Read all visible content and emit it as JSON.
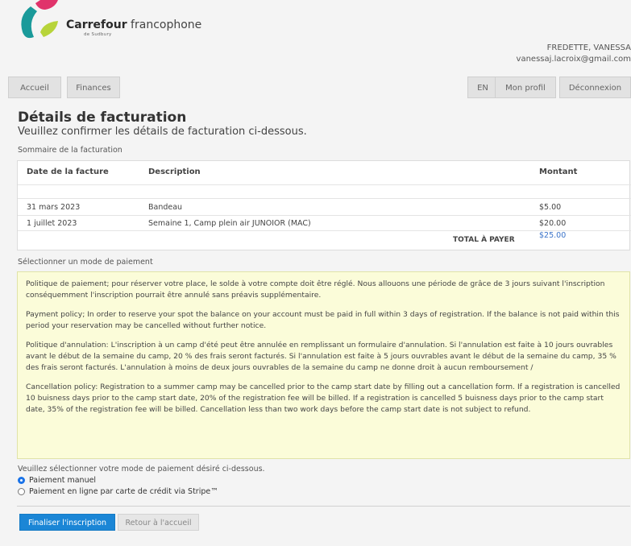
{
  "brand": {
    "name_bold": "Carrefour",
    "name_light": " francophone",
    "sub": "de Sudbury",
    "colors": {
      "pink": "#e0336b",
      "teal": "#1a9a9a",
      "green": "#b7d43a"
    }
  },
  "user": {
    "name": "FREDETTE, VANESSA",
    "email": "vanessaj.lacroix@gmail.com"
  },
  "nav": {
    "left": [
      "Accueil",
      "Finances"
    ],
    "right": [
      "EN",
      "Mon profil",
      "Déconnexion"
    ]
  },
  "page": {
    "title": "Détails de facturation",
    "subtitle": "Veuillez confirmer les détails de facturation ci-dessous.",
    "summary_label": "Sommaire de la facturation"
  },
  "table": {
    "headers": [
      "Date de la facture",
      "Description",
      "Montant"
    ],
    "rows": [
      {
        "date": "31 mars 2023",
        "description": "Bandeau",
        "amount": "$5.00"
      },
      {
        "date": "1 juillet 2023",
        "description": "Semaine 1, Camp plein air JUNOIOR (MAC)",
        "amount": "$20.00"
      }
    ],
    "total_label": "TOTAL À PAYER",
    "total_value": "$25.00"
  },
  "payment": {
    "section_label": "Sélectionner un mode de paiement",
    "policies": [
      "Politique de paiement; pour réserver votre place, le solde à votre compte doit être réglé. Nous allouons une période de grâce de 3 jours suivant l'inscription conséquemment l'inscription pourrait être annulé sans préavis supplémentaire.",
      "Payment policy; In order to reserve your spot the balance on your account must be paid in full within 3 days of registration. If the balance is not paid within this period your reservation may be cancelled without further notice.",
      "Politique d'annulation: L'inscription à un camp d'été peut être annulée en remplissant un formulaire d'annulation. Si l'annulation est faite à 10 jours ouvrables avant le début de la semaine du camp, 20 % des frais seront facturés. Si l'annulation est faite à 5 jours ouvrables avant le début de la semaine du camp, 35 % des frais seront facturés. L'annulation à moins de deux jours ouvrables de la semaine du camp ne donne droit à aucun remboursement /",
      "Cancellation policy: Registration to a summer camp may be cancelled prior to the camp start date by filling out a cancellation form. If a registration is cancelled 10 buisness days prior to the camp start date, 20% of the registration fee will be billed. If a registration is cancelled 5 buisness days prior to the camp start date, 35% of the registration fee will be billed. Cancellation less than two work days before the camp start date is not subject to refund."
    ],
    "choose_label": "Veuillez sélectionner votre mode de paiement désiré ci-dessous.",
    "options": [
      {
        "label": "Paiement manuel",
        "checked": true
      },
      {
        "label": "Paiement en ligne par carte de crédit via Stripe™",
        "checked": false
      }
    ]
  },
  "actions": {
    "finalize": "Finaliser l'inscription",
    "back": "Retour à l'accueil"
  }
}
